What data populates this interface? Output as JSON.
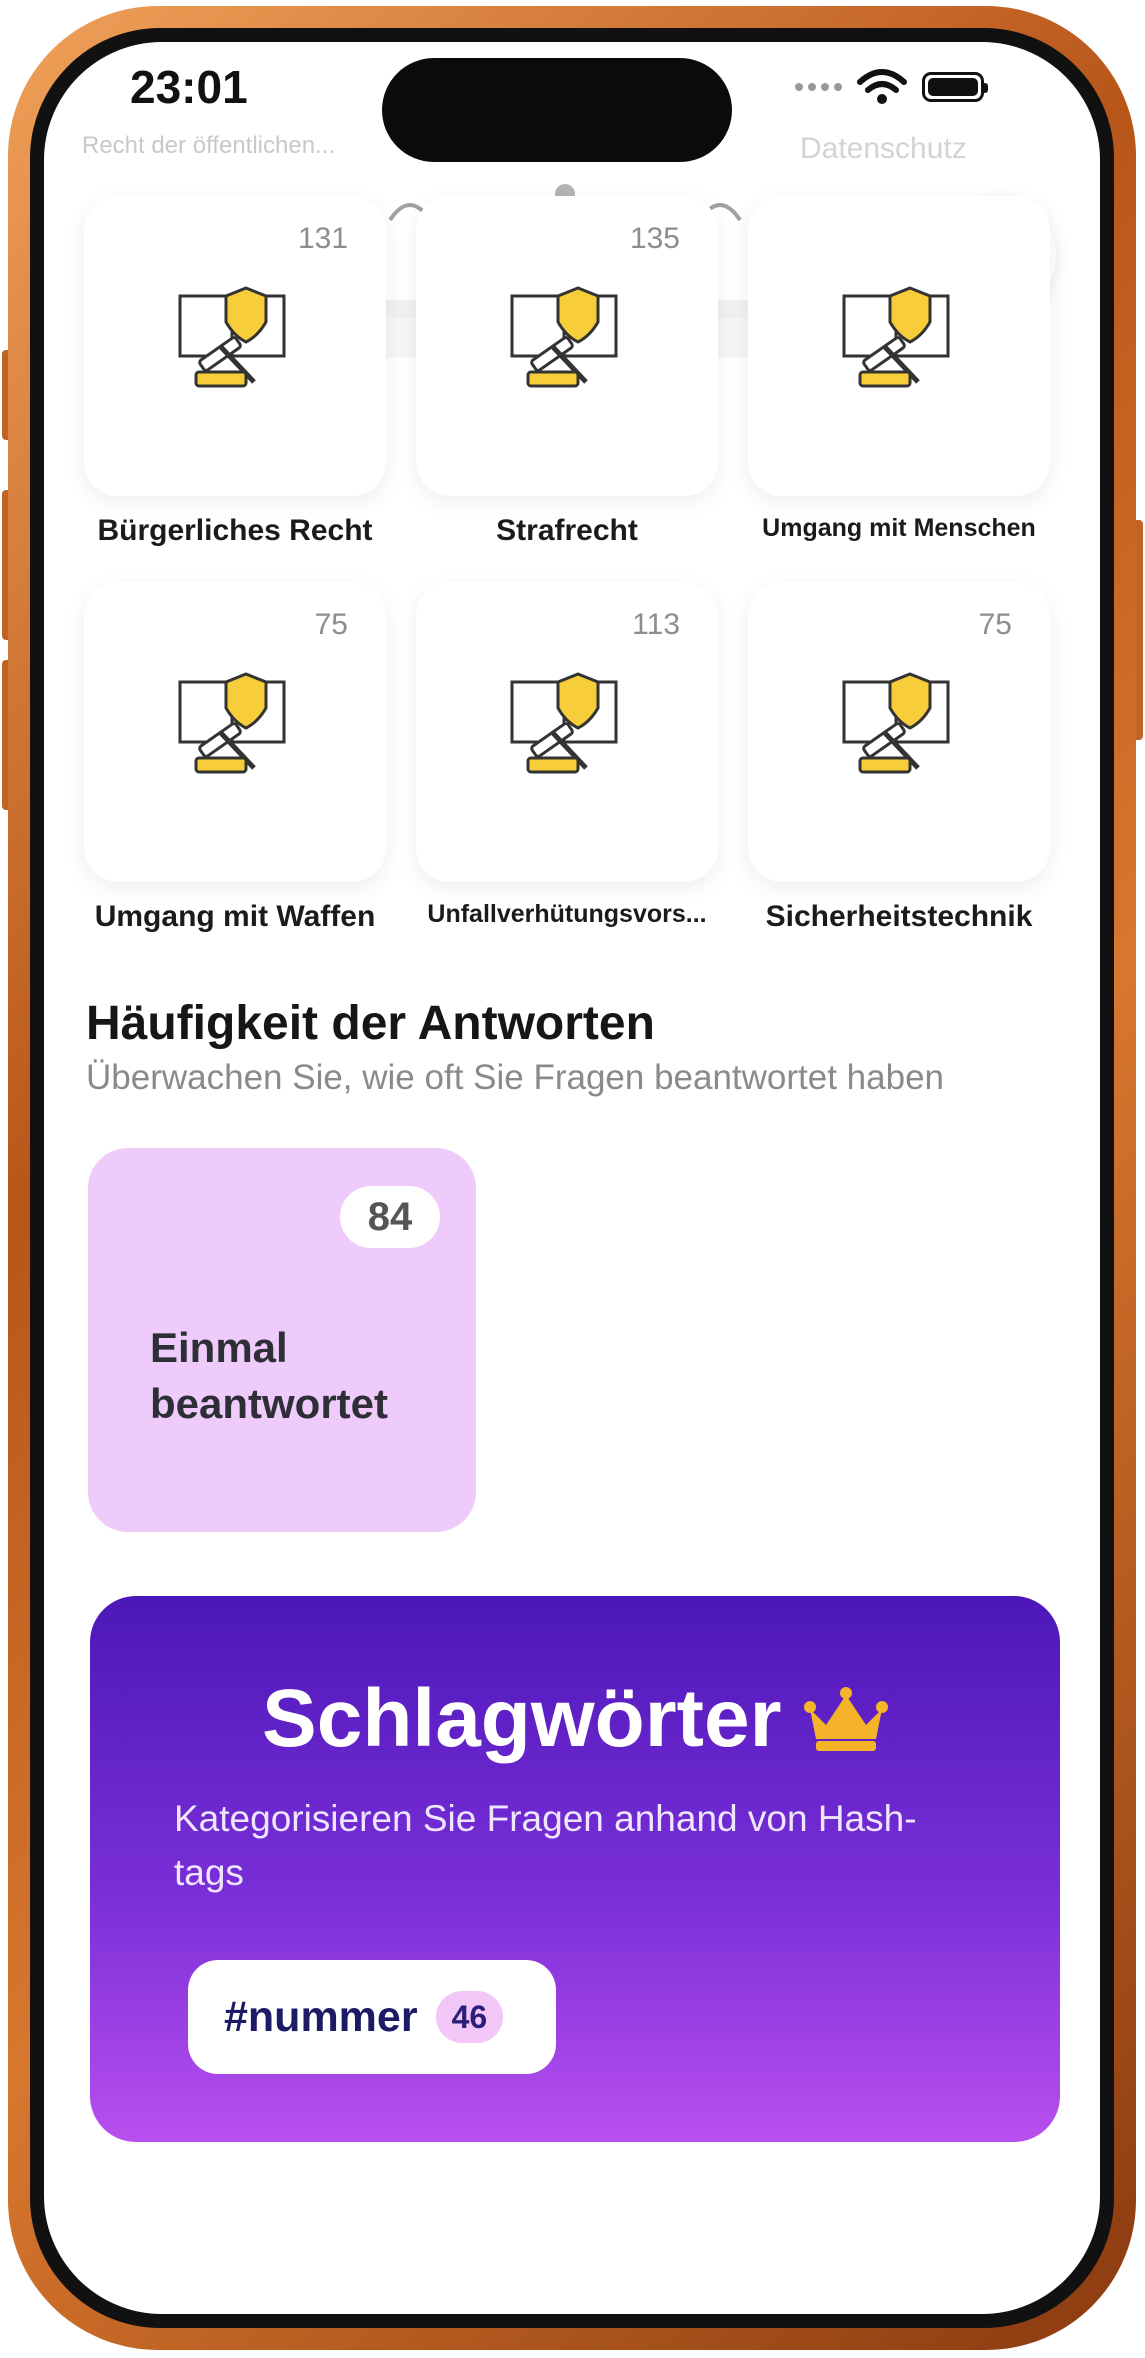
{
  "status_bar": {
    "time": "23:01"
  },
  "header": {
    "faded_title": "Recht der öffentlichen...",
    "faded_link": "Datenschutz"
  },
  "categories": [
    {
      "label": "Bürgerliches Recht",
      "count": "131"
    },
    {
      "label": "Strafrecht",
      "count": "135"
    },
    {
      "label": "Umgang mit Menschen",
      "count": ""
    },
    {
      "label": "Umgang mit Waffen",
      "count": "75"
    },
    {
      "label": "Unfallverhütungsvors...",
      "count": "113"
    },
    {
      "label": "Sicherheitstechnik",
      "count": "75"
    }
  ],
  "answers_section": {
    "title": "Häufigkeit der Antworten",
    "subtitle": "Überwachen Sie, wie oft Sie Fragen beantwortet haben",
    "card": {
      "count": "84",
      "label": "Einmal beantwortet"
    }
  },
  "premium": {
    "title": "Schlagwörter",
    "subtitle": "Kategorisieren Sie Fragen anhand von Hash-tags",
    "tag": {
      "name": "#nummer",
      "count": "46"
    }
  },
  "colors": {
    "frame": "#b8561a",
    "answer_card": "#eecbfb",
    "premium_top": "#4c17b8",
    "premium_bottom": "#b94fef",
    "crown": "#f5b32a",
    "gear": "#1d1a66"
  },
  "icons": [
    "law-book-icon",
    "gear-icon",
    "crown-icon",
    "wifi-icon",
    "battery-icon"
  ]
}
